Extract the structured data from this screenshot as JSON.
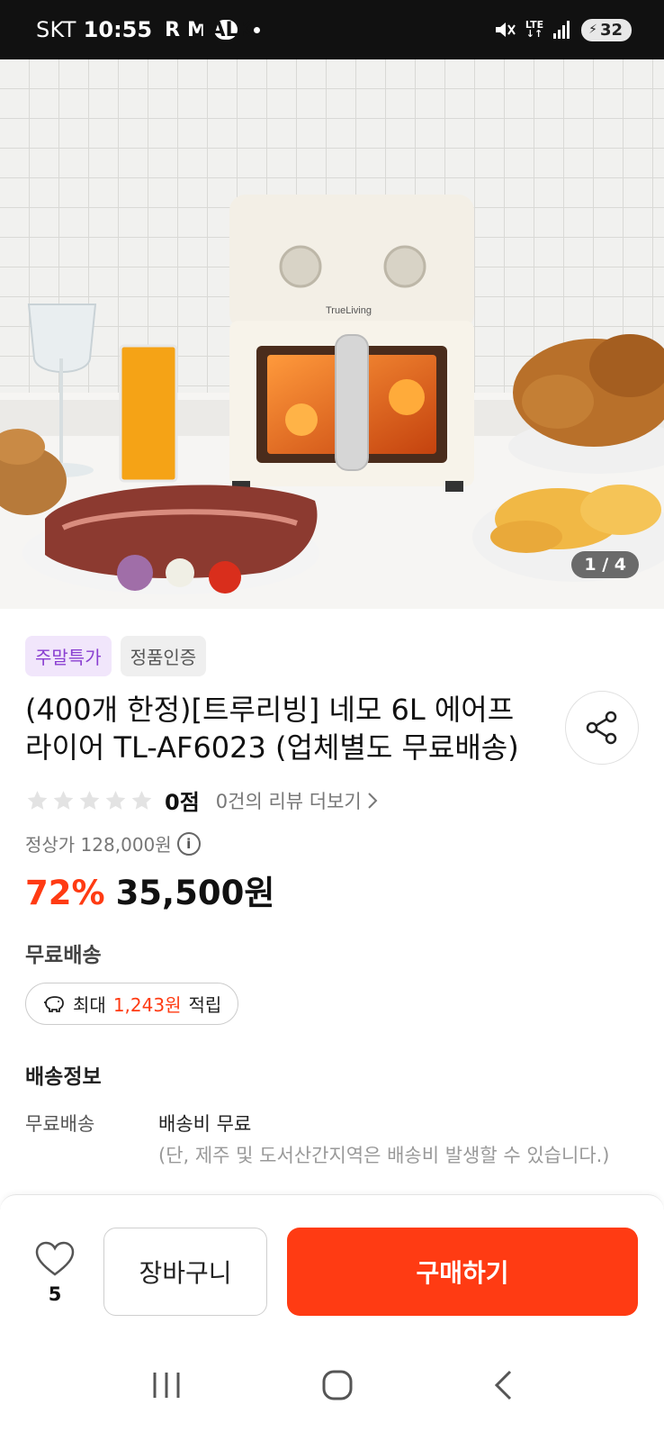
{
  "status_bar": {
    "carrier": "SKT",
    "time": "10:55",
    "app_icons": [
      "R",
      "M"
    ],
    "talk": "TALK",
    "network": "LTE",
    "battery": "32"
  },
  "hero": {
    "brand_on_product": "TrueLiving",
    "pager": "1 / 4"
  },
  "product": {
    "tags": [
      "주말특가",
      "정품인증"
    ],
    "title": "(400개 한정)[트루리빙] 네모 6L 에어프라이어 TL-AF6023 (업체별도 무료배송)",
    "rating_stars": 0,
    "score": "0점",
    "review_link": "0건의 리뷰 더보기",
    "original_price": "정상가 128,000원",
    "discount": "72%",
    "price": "35,500원",
    "free_shipping": "무료배송",
    "points_prefix": "최대",
    "points_amount": "1,243원",
    "points_suffix": "적립"
  },
  "shipping": {
    "section_title": "배송정보",
    "label": "무료배송",
    "value": "배송비 무료",
    "note": "(단, 제주 및 도서산간지역은 배송비 발생할 수 있습니다.)"
  },
  "bottom_bar": {
    "like_count": "5",
    "cart_label": "장바구니",
    "buy_label": "구매하기"
  },
  "colors": {
    "accent": "#ff3b13",
    "tag_purple": "#8a3fd1"
  }
}
